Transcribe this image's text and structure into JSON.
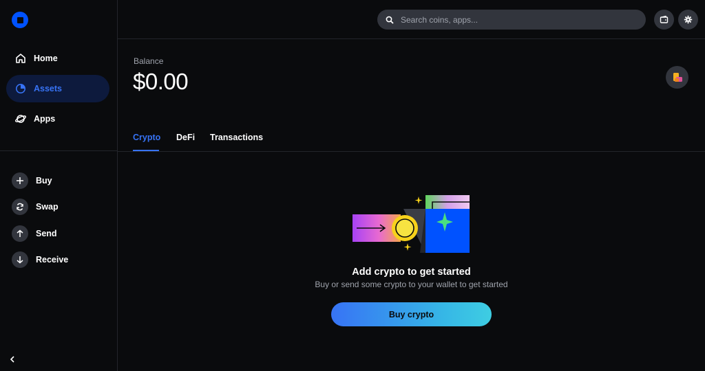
{
  "sidebar": {
    "logo": "coinbase-wallet-logo",
    "nav": [
      {
        "label": "Home",
        "icon": "home-icon"
      },
      {
        "label": "Assets",
        "icon": "pie-chart-icon",
        "active": true
      },
      {
        "label": "Apps",
        "icon": "planet-icon"
      }
    ],
    "actions": [
      {
        "label": "Buy",
        "icon": "plus-icon"
      },
      {
        "label": "Swap",
        "icon": "swap-icon"
      },
      {
        "label": "Send",
        "icon": "arrow-up-icon"
      },
      {
        "label": "Receive",
        "icon": "arrow-down-icon"
      }
    ]
  },
  "search": {
    "placeholder": "Search coins, apps..."
  },
  "balance": {
    "label": "Balance",
    "value": "$0.00"
  },
  "tabs": [
    {
      "label": "Crypto",
      "active": true
    },
    {
      "label": "DeFi"
    },
    {
      "label": "Transactions"
    }
  ],
  "empty_state": {
    "title": "Add crypto to get started",
    "subtitle": "Buy or send some crypto to your wallet to get started",
    "button_label": "Buy crypto"
  },
  "colors": {
    "background": "#0a0b0d",
    "accent": "#3773f5",
    "surface": "#32353d",
    "active_nav_bg": "#0d1a3d",
    "muted_text": "#a0a4ad"
  }
}
